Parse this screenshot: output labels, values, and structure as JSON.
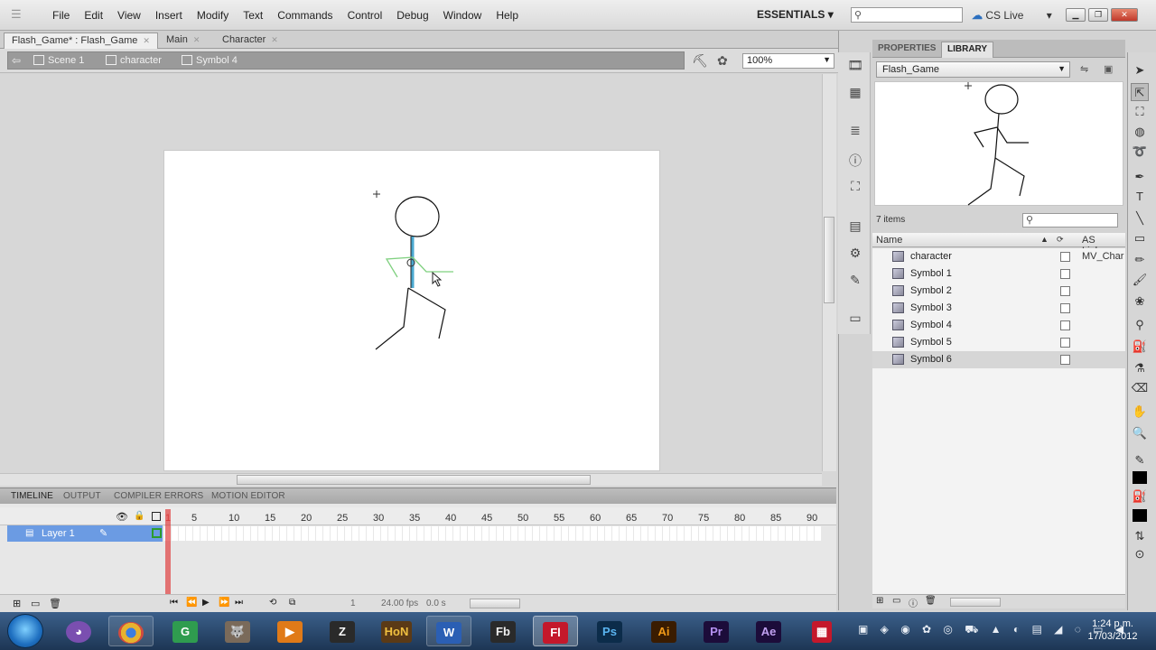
{
  "app": {
    "menus": [
      "File",
      "Edit",
      "View",
      "Insert",
      "Modify",
      "Text",
      "Commands",
      "Control",
      "Debug",
      "Window",
      "Help"
    ],
    "workspace": "ESSENTIALS",
    "cslive": "CS Live",
    "window_controls": [
      "minimize",
      "restore",
      "close"
    ]
  },
  "doc_tabs": [
    {
      "label": "Flash_Game* : Flash_Game",
      "active": true
    },
    {
      "label": "Main",
      "active": false
    },
    {
      "label": "Character",
      "active": false
    }
  ],
  "edit_bar": {
    "breadcrumbs": [
      "Scene 1",
      "character",
      "Symbol 4"
    ],
    "zoom": "100%"
  },
  "panel_tabs": [
    "TIMELINE",
    "OUTPUT",
    "COMPILER ERRORS",
    "MOTION EDITOR"
  ],
  "timeline": {
    "frame_numbers": [
      "1",
      "5",
      "10",
      "15",
      "20",
      "25",
      "30",
      "35",
      "40",
      "45",
      "50",
      "55",
      "60",
      "65",
      "70",
      "75",
      "80",
      "85",
      "90"
    ],
    "layer_name": "Layer 1",
    "current_frame": "1",
    "fps": "24.00 fps",
    "time": "0.0 s"
  },
  "library": {
    "tabs": [
      "PROPERTIES",
      "LIBRARY"
    ],
    "document": "Flash_Game",
    "item_count": "7 items",
    "columns": [
      "Name",
      "AS Linkage"
    ],
    "items": [
      {
        "name": "character",
        "linkage": "MV_Char"
      },
      {
        "name": "Symbol 1",
        "linkage": ""
      },
      {
        "name": "Symbol 2",
        "linkage": ""
      },
      {
        "name": "Symbol 3",
        "linkage": ""
      },
      {
        "name": "Symbol 4",
        "linkage": ""
      },
      {
        "name": "Symbol 5",
        "linkage": ""
      },
      {
        "name": "Symbol 6",
        "linkage": ""
      }
    ]
  },
  "taskbar": {
    "apps": [
      "Firefox",
      "Chrome",
      "Greenshot",
      "Gimp",
      "VLC",
      "ZBrush",
      "HON",
      "Word",
      "Flash Builder",
      "Flash",
      "Photoshop",
      "Illustrator",
      "Premiere",
      "After Effects"
    ],
    "labels": {
      "word": "W",
      "fb": "Fb",
      "fl": "Fl",
      "ps": "Ps",
      "ai": "Ai",
      "pr": "Pr",
      "ae": "Ae"
    },
    "time": "1:24 p.m.",
    "date": "17/03/2012"
  },
  "colors": {
    "stage_bg": "#ffffff",
    "layer_selected": "#6b9be3",
    "taskbar": "#1d3654",
    "flash_red": "#c4182b"
  }
}
